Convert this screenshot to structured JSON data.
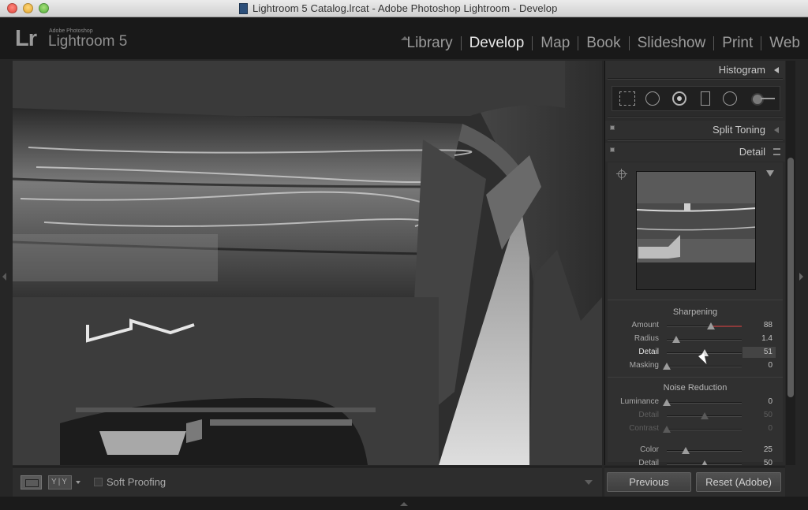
{
  "window": {
    "title": "Lightroom 5 Catalog.lrcat - Adobe Photoshop Lightroom - Develop"
  },
  "brand": {
    "logo": "Lr",
    "subtitle": "Adobe Photoshop",
    "name": "Lightroom 5"
  },
  "modules": [
    {
      "label": "Library"
    },
    {
      "label": "Develop"
    },
    {
      "label": "Map"
    },
    {
      "label": "Book"
    },
    {
      "label": "Slideshow"
    },
    {
      "label": "Print"
    },
    {
      "label": "Web"
    }
  ],
  "active_module": "Develop",
  "panels": {
    "histogram": "Histogram",
    "split_toning": "Split Toning",
    "detail": "Detail"
  },
  "tools": [
    "grid-overlay-icon",
    "crop-icon",
    "spot-removal-icon",
    "graduated-filter-icon",
    "radial-filter-icon",
    "adjustment-brush-icon"
  ],
  "sharpening": {
    "title": "Sharpening",
    "sliders": [
      {
        "label": "Amount",
        "value": "88",
        "level": 0.59
      },
      {
        "label": "Radius",
        "value": "1.4",
        "level": 0.13
      },
      {
        "label": "Detail",
        "value": "51",
        "level": 0.51
      },
      {
        "label": "Masking",
        "value": "0",
        "level": 0.0
      }
    ]
  },
  "noise_reduction": {
    "title": "Noise Reduction",
    "sliders": [
      {
        "label": "Luminance",
        "value": "0",
        "level": 0.0
      },
      {
        "label": "Detail",
        "value": "50",
        "level": 0.5
      },
      {
        "label": "Contrast",
        "value": "0",
        "level": 0.0
      },
      {
        "label": "Color",
        "value": "25",
        "level": 0.25
      },
      {
        "label": "Detail",
        "value": "50",
        "level": 0.5
      }
    ]
  },
  "toolbar": {
    "yy_label": "Y|Y",
    "soft_proofing": "Soft Proofing"
  },
  "buttons": {
    "previous": "Previous",
    "reset": "Reset (Adobe)"
  }
}
